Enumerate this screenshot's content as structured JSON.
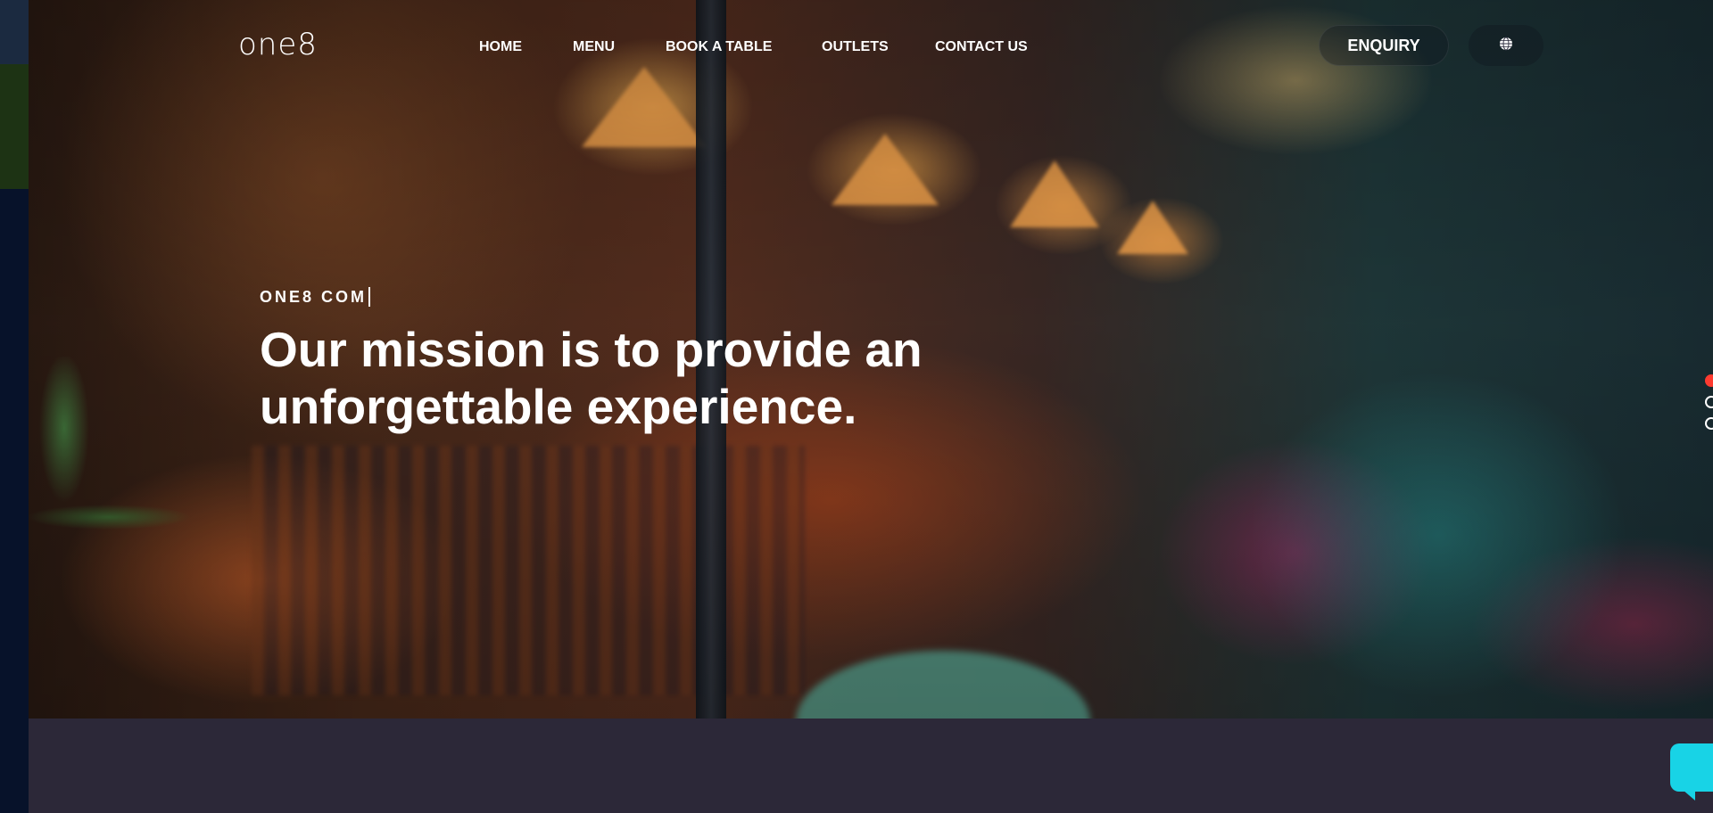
{
  "brand": {
    "logo_text": "one8"
  },
  "nav": {
    "items": [
      {
        "label": "HOME"
      },
      {
        "label": "MENU"
      },
      {
        "label": "BOOK A TABLE"
      },
      {
        "label": "OUTLETS"
      },
      {
        "label": "CONTACT US"
      }
    ]
  },
  "header": {
    "enquiry_label": "ENQUIRY",
    "language_icon": "globe-icon"
  },
  "hero": {
    "subtitle": "ONE8 COM",
    "headline": "Our mission is to provide an unforgettable experience.",
    "slide_indicator": {
      "count": 3,
      "active_index": 0
    }
  },
  "chat": {
    "icon": "chat-icon",
    "color": "#18d3e6"
  },
  "colors": {
    "page_dark": "#07122a",
    "footer_band": "#2c2838",
    "active_dot": "#ff3b30",
    "text": "#ffffff"
  }
}
